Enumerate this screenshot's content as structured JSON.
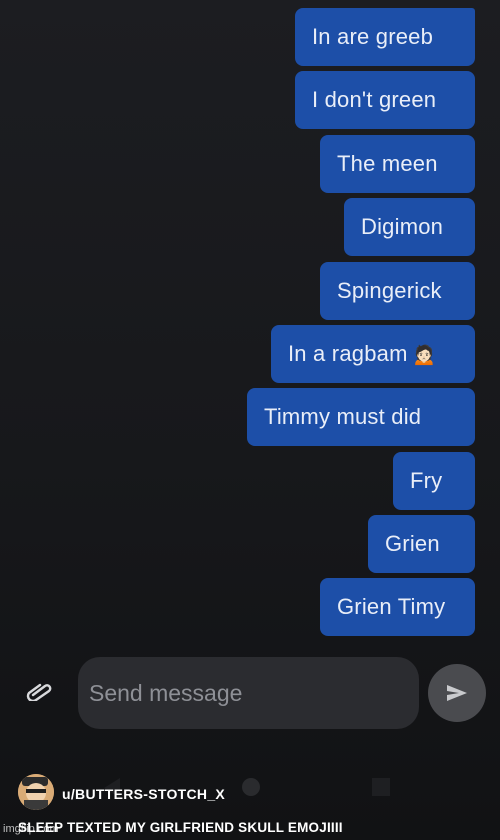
{
  "messages": [
    {
      "text": "In are greeb",
      "emoji": ""
    },
    {
      "text": "I don't green",
      "emoji": ""
    },
    {
      "text": "The meen",
      "emoji": ""
    },
    {
      "text": "Digimon",
      "emoji": ""
    },
    {
      "text": "Spingerick",
      "emoji": ""
    },
    {
      "text": "In a ragbam",
      "emoji": "🙍🏻"
    },
    {
      "text": "Timmy must did",
      "emoji": ""
    },
    {
      "text": "Fry",
      "emoji": ""
    },
    {
      "text": "Grien",
      "emoji": ""
    },
    {
      "text": "Grien Timy",
      "emoji": ""
    }
  ],
  "composer": {
    "placeholder": "Send message",
    "attach_icon": "paperclip-icon",
    "send_icon": "send-arrow-icon"
  },
  "navbar": {
    "icons": [
      "back-triangle-icon",
      "home-circle-icon",
      "recents-square-icon"
    ]
  },
  "footer": {
    "username": "u/BUTTERS-STOTCH_X",
    "caption": "SLEEP TEXTED MY GIRLFRIEND SKULL EMOJIIII",
    "watermark": "imgflip.com"
  },
  "colors": {
    "bubble": "#1d4fa8",
    "background": "#1a1b1e",
    "input": "#2b2c30",
    "send_button": "#4a4b4f"
  }
}
